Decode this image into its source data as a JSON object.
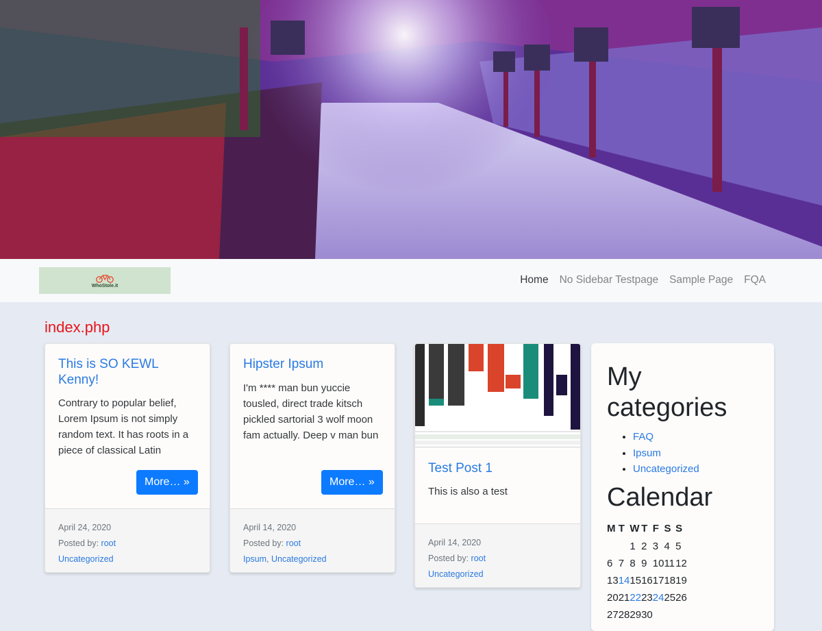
{
  "nav": {
    "logo_text": "WhoStole.it",
    "links": [
      "Home",
      "No Sidebar Testpage",
      "Sample Page",
      "FQA"
    ]
  },
  "page_label": "index.php",
  "posts": [
    {
      "title": "This is SO KEWL Kenny!",
      "excerpt": "Contrary to popular belief, Lorem Ipsum is not simply random text. It has roots in a piece of classical Latin",
      "more": "More… »",
      "date": "April 24, 2020",
      "posted_by_label": "Posted by: ",
      "author": "root",
      "categories": [
        "Uncategorized"
      ]
    },
    {
      "title": "Hipster Ipsum",
      "excerpt": "I'm **** man bun yuccie tousled, direct trade kitsch pickled sartorial 3 wolf moon fam actually. Deep v man bun",
      "more": "More… »",
      "date": "April 14, 2020",
      "posted_by_label": "Posted by: ",
      "author": "root",
      "categories": [
        "Ipsum",
        "Uncategorized"
      ],
      "sep": ", "
    },
    {
      "title": "Test Post 1",
      "excerpt": "This is also a test",
      "date": "April 14, 2020",
      "posted_by_label": "Posted by: ",
      "author": "root",
      "categories": [
        "Uncategorized"
      ]
    }
  ],
  "sidebar": {
    "categories_title": "My categories",
    "categories": [
      "FAQ",
      "Ipsum",
      "Uncategorized"
    ],
    "calendar_title": "Calendar",
    "weekdays": [
      "M",
      "T",
      "W",
      "T",
      "F",
      "S",
      "S"
    ],
    "weeks": [
      [
        "",
        "",
        "1",
        "2",
        "3",
        "4",
        "5"
      ],
      [
        "6",
        "7",
        "8",
        "9",
        "10",
        "11",
        "12"
      ],
      [
        "13",
        "14",
        "15",
        "16",
        "17",
        "18",
        "19"
      ],
      [
        "20",
        "21",
        "22",
        "23",
        "24",
        "25",
        "26"
      ],
      [
        "27",
        "28",
        "29",
        "30",
        "",
        "",
        ""
      ]
    ],
    "linked_days": [
      "14",
      "22",
      "24"
    ]
  },
  "colors": {
    "accent": "#2a7ae2",
    "button": "#0d7bff",
    "page_label": "#e8141c"
  }
}
